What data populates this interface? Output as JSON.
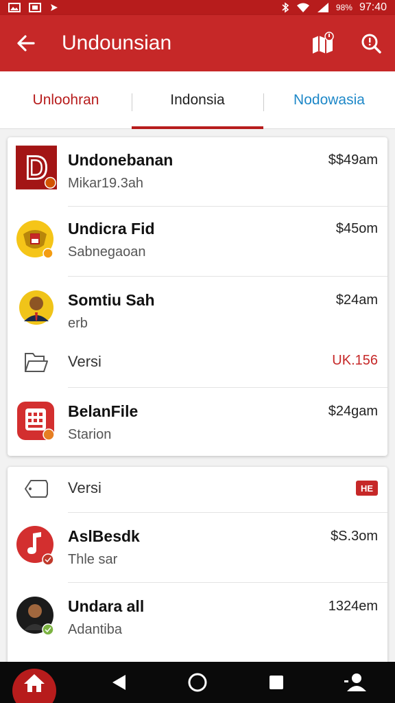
{
  "status_bar": {
    "battery": "98%",
    "time": "97:40"
  },
  "app_bar": {
    "title": "Undounsian"
  },
  "tabs": [
    {
      "label": "Unloohran"
    },
    {
      "label": "Indonsia"
    },
    {
      "label": "Nodowasia"
    }
  ],
  "list1": [
    {
      "name": "Undonebanan",
      "subtitle": "Mikar19.3ah",
      "amount": "$$49am"
    },
    {
      "name": "Undicra Fid",
      "subtitle": "Sabnegaoan",
      "amount": "$45om"
    },
    {
      "name": "Somtiu Sah",
      "subtitle": "erb",
      "amount": "$24am"
    },
    {
      "label": "Versi",
      "amount": "UK.156"
    },
    {
      "name": "BelanFile",
      "subtitle": "Starion",
      "amount": "$24gam"
    }
  ],
  "list2": [
    {
      "label": "Versi",
      "badge": "HE"
    },
    {
      "name": "AslBesdk",
      "subtitle": "Thle sar",
      "amount": "$S.3om"
    },
    {
      "name": "Undara all",
      "subtitle": "Adantiba",
      "amount": "1324em"
    }
  ],
  "colors": {
    "primary": "#c62828",
    "primary_dark": "#b71c1c",
    "accent_blue": "#1e88c8"
  }
}
